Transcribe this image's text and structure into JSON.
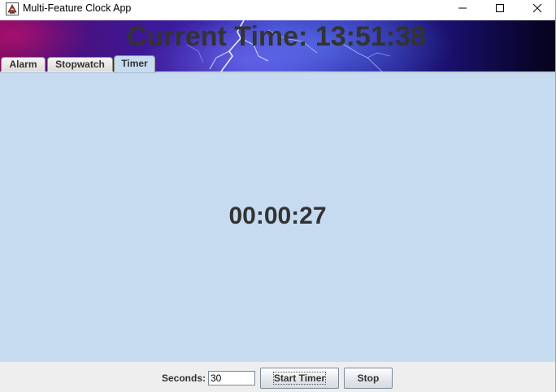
{
  "window": {
    "title": "Multi-Feature Clock App"
  },
  "banner": {
    "current_time": "Current Time: 13:51:38"
  },
  "tabs": [
    {
      "label": "Alarm",
      "selected": false
    },
    {
      "label": "Stopwatch",
      "selected": false
    },
    {
      "label": "Timer",
      "selected": true
    }
  ],
  "timer": {
    "display": "00:00:27"
  },
  "controls": {
    "seconds_label": "Seconds:",
    "seconds_value": "30",
    "start_label": "Start Timer",
    "stop_label": "Stop"
  },
  "colors": {
    "content_bg": "#c6dbf0",
    "text": "#333333"
  },
  "icons": {
    "app": "java-cup-icon",
    "minimize": "minimize-icon",
    "maximize": "maximize-icon",
    "close": "close-icon"
  }
}
